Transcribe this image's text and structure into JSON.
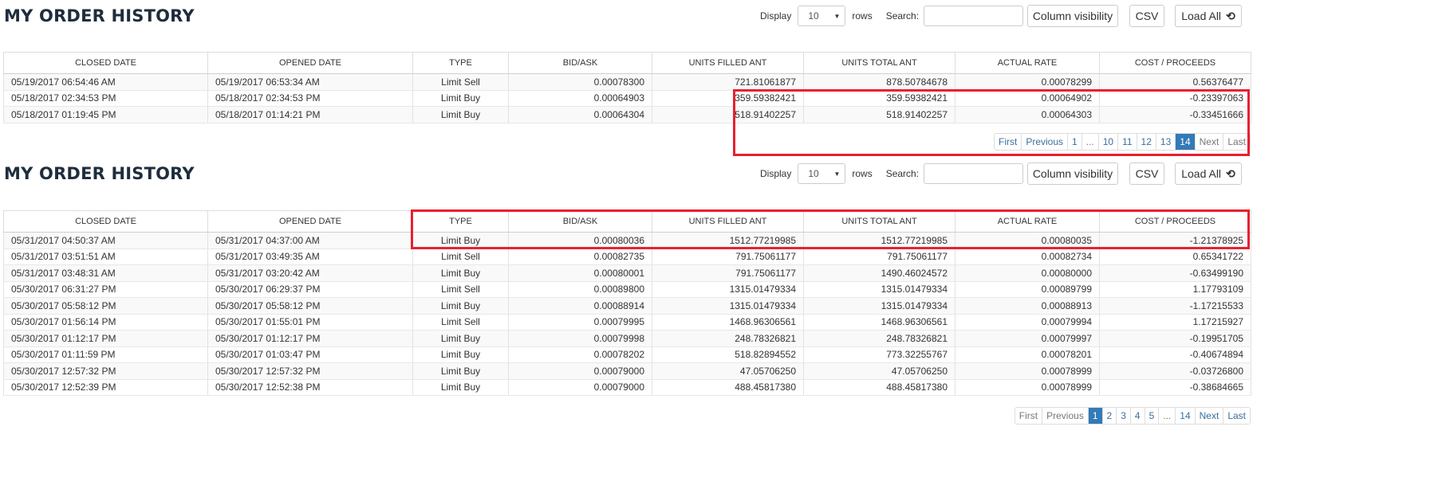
{
  "section1": {
    "title": "MY ORDER HISTORY",
    "controls": {
      "display_label": "Display",
      "rows_value": "10",
      "rows_label": "rows",
      "search_label": "Search:",
      "search_value": "",
      "column_visibility_label": "Column visibility",
      "csv_label": "CSV",
      "load_all_label": "Load All",
      "load_all_icon": "reload-icon"
    },
    "headers": [
      "CLOSED DATE",
      "OPENED DATE",
      "TYPE",
      "BID/ASK",
      "UNITS FILLED ANT",
      "UNITS TOTAL ANT",
      "ACTUAL RATE",
      "COST / PROCEEDS"
    ],
    "rows": [
      [
        "05/19/2017 06:54:46 AM",
        "05/19/2017 06:53:34 AM",
        "Limit Sell",
        "0.00078300",
        "721.81061877",
        "878.50784678",
        "0.00078299",
        "0.56376477"
      ],
      [
        "05/18/2017 02:34:53 PM",
        "05/18/2017 02:34:53 PM",
        "Limit Buy",
        "0.00064903",
        "359.59382421",
        "359.59382421",
        "0.00064902",
        "-0.23397063"
      ],
      [
        "05/18/2017 01:19:45 PM",
        "05/18/2017 01:14:21 PM",
        "Limit Buy",
        "0.00064304",
        "518.91402257",
        "518.91402257",
        "0.00064303",
        "-0.33451666"
      ]
    ],
    "pagination": [
      "First",
      "Previous",
      "1",
      "...",
      "10",
      "11",
      "12",
      "13",
      "14",
      "Next",
      "Last"
    ],
    "active_page": "14"
  },
  "section2": {
    "title": "MY ORDER HISTORY",
    "controls": {
      "display_label": "Display",
      "rows_value": "10",
      "rows_label": "rows",
      "search_label": "Search:",
      "search_value": "",
      "column_visibility_label": "Column visibility",
      "csv_label": "CSV",
      "load_all_label": "Load All",
      "load_all_icon": "reload-icon"
    },
    "headers": [
      "CLOSED DATE",
      "OPENED DATE",
      "TYPE",
      "BID/ASK",
      "UNITS FILLED ANT",
      "UNITS TOTAL ANT",
      "ACTUAL RATE",
      "COST / PROCEEDS"
    ],
    "rows": [
      [
        "05/31/2017 04:50:37 AM",
        "05/31/2017 04:37:00 AM",
        "Limit Buy",
        "0.00080036",
        "1512.77219985",
        "1512.77219985",
        "0.00080035",
        "-1.21378925"
      ],
      [
        "05/31/2017 03:51:51 AM",
        "05/31/2017 03:49:35 AM",
        "Limit Sell",
        "0.00082735",
        "791.75061177",
        "791.75061177",
        "0.00082734",
        "0.65341722"
      ],
      [
        "05/31/2017 03:48:31 AM",
        "05/31/2017 03:20:42 AM",
        "Limit Buy",
        "0.00080001",
        "791.75061177",
        "1490.46024572",
        "0.00080000",
        "-0.63499190"
      ],
      [
        "05/30/2017 06:31:27 PM",
        "05/30/2017 06:29:37 PM",
        "Limit Sell",
        "0.00089800",
        "1315.01479334",
        "1315.01479334",
        "0.00089799",
        "1.17793109"
      ],
      [
        "05/30/2017 05:58:12 PM",
        "05/30/2017 05:58:12 PM",
        "Limit Buy",
        "0.00088914",
        "1315.01479334",
        "1315.01479334",
        "0.00088913",
        "-1.17215533"
      ],
      [
        "05/30/2017 01:56:14 PM",
        "05/30/2017 01:55:01 PM",
        "Limit Sell",
        "0.00079995",
        "1468.96306561",
        "1468.96306561",
        "0.00079994",
        "1.17215927"
      ],
      [
        "05/30/2017 01:12:17 PM",
        "05/30/2017 01:12:17 PM",
        "Limit Buy",
        "0.00079998",
        "248.78326821",
        "248.78326821",
        "0.00079997",
        "-0.19951705"
      ],
      [
        "05/30/2017 01:11:59 PM",
        "05/30/2017 01:03:47 PM",
        "Limit Buy",
        "0.00078202",
        "518.82894552",
        "773.32255767",
        "0.00078201",
        "-0.40674894"
      ],
      [
        "05/30/2017 12:57:32 PM",
        "05/30/2017 12:57:32 PM",
        "Limit Buy",
        "0.00079000",
        "47.05706250",
        "47.05706250",
        "0.00078999",
        "-0.03726800"
      ],
      [
        "05/30/2017 12:52:39 PM",
        "05/30/2017 12:52:38 PM",
        "Limit Buy",
        "0.00079000",
        "488.45817380",
        "488.45817380",
        "0.00078999",
        "-0.38684665"
      ]
    ],
    "pagination": [
      "First",
      "Previous",
      "1",
      "2",
      "3",
      "4",
      "5",
      "...",
      "14",
      "Next",
      "Last"
    ],
    "active_page": "1"
  },
  "highlight_color": "#e8202f",
  "active_page_color": "#337ab7"
}
